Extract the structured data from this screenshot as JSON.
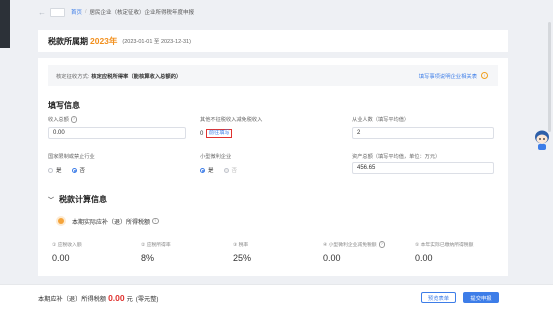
{
  "breadcrumb": {
    "home": "首页",
    "separator": "/",
    "current": "居民企业（核定征收）企业所得税年度申报"
  },
  "period": {
    "label": "税款所属期",
    "year": "2023年",
    "range": "(2023-01-01 至 2023-12-31)"
  },
  "method": {
    "label": "核定征收方式:",
    "value": "核定应税所得率（能核算收入总额的）",
    "link": "填写事项说明企业相关表",
    "info_icon": "info-circle-icon"
  },
  "form": {
    "title": "填写信息",
    "revenue_label": "收入总额",
    "revenue_value": "0.00",
    "nontax_label": "其他不征税收入减免税收入",
    "nontax_value": "0",
    "nontax_link": "前往填写",
    "employees_label": "从业人数（填写平均值）",
    "employees_value": "2",
    "restricted_label": "国家限制或禁止行业",
    "restricted_options": [
      "是",
      "否"
    ],
    "restricted_selected": "否",
    "small_label": "小型微利企业",
    "small_options": [
      "是",
      "否"
    ],
    "small_selected": "是",
    "assets_label": "资产总额（填写平均值，单位：万元）",
    "assets_value": "456.65"
  },
  "calc": {
    "title": "税款计算信息",
    "subtitle": "本期实际应补（退）所得税额",
    "metrics": [
      {
        "label": "① 应税收入额",
        "value": "0.00"
      },
      {
        "label": "② 应税所得率",
        "value": "8%"
      },
      {
        "label": "③ 税率",
        "value": "25%"
      },
      {
        "label": "④ 小型微利企业减免税额",
        "value": "0.00"
      },
      {
        "label": "⑤ 本年实际已缴纳所得税额",
        "value": "0.00"
      }
    ]
  },
  "footer": {
    "due_prefix": "本期应补（退）所得税额",
    "due_amount": "0.00",
    "due_unit": "元",
    "due_caps": "(零元整)",
    "preview_button": "预览表单",
    "submit_button": "提交申报"
  },
  "colors": {
    "accent": "#3d7de8",
    "year": "#f28f1c",
    "danger": "#e0322f"
  }
}
